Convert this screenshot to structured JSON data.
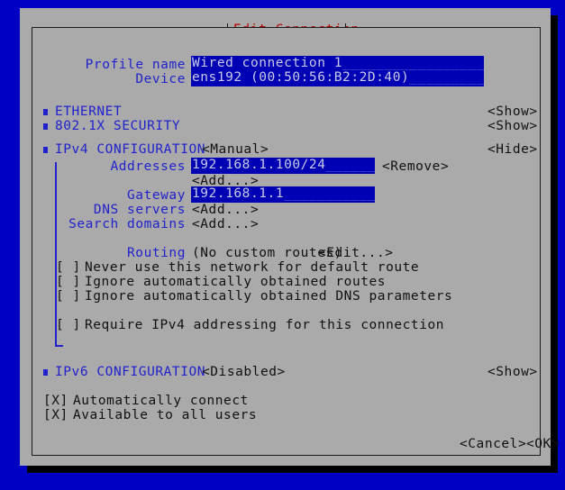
{
  "window": {
    "title": "Edit Connection",
    "accent_blue": "#0000c4",
    "panel_gray": "#aaaaaa",
    "label_blue": "#2222cc",
    "title_red": "#b00000",
    "field_blue": "#0000b5"
  },
  "form": {
    "profile_name": {
      "label": "Profile name",
      "value": "Wired connection 1",
      "fill": "____________________"
    },
    "device": {
      "label": "Device",
      "value": "ens192 (00:50:56:B2:2D:40)",
      "fill": "____________"
    }
  },
  "sections": [
    {
      "name": "ethernet",
      "label": "ETHERNET",
      "toggle": "<Show>"
    },
    {
      "name": "security",
      "label": "802.1X SECURITY",
      "toggle": "<Show>"
    },
    {
      "name": "ipv4",
      "label": "IPv4 CONFIGURATION",
      "mode": "<Manual>",
      "toggle": "<Hide>"
    },
    {
      "name": "ipv6",
      "label": "IPv6 CONFIGURATION",
      "mode": "<Disabled>",
      "toggle": "<Show>"
    }
  ],
  "ipv4": {
    "addresses": {
      "label": "Addresses",
      "value": "192.168.1.100/24",
      "fill": "________",
      "remove_label": "<Remove>",
      "add_label": "<Add...>"
    },
    "gateway": {
      "label": "Gateway",
      "value": "192.168.1.1",
      "fill": "____________"
    },
    "dns_servers": {
      "label": "DNS servers",
      "add_label": "<Add...>"
    },
    "search_domains": {
      "label": "Search domains",
      "add_label": "<Add...>"
    },
    "routing": {
      "label": "Routing",
      "summary": "(No custom routes)",
      "edit_label": "<Edit...>"
    },
    "checkboxes": [
      {
        "name": "never-default-route",
        "mark": "[ ]",
        "label": "Never use this network for default route"
      },
      {
        "name": "ignore-auto-routes",
        "mark": "[ ]",
        "label": "Ignore automatically obtained routes"
      },
      {
        "name": "ignore-auto-dns",
        "mark": "[ ]",
        "label": "Ignore automatically obtained DNS parameters"
      },
      {
        "name": "require-ipv4",
        "mark": "[ ]",
        "label": "Require IPv4 addressing for this connection"
      }
    ]
  },
  "global_options": [
    {
      "name": "automatically-connect",
      "mark": "[X]",
      "label": "Automatically connect"
    },
    {
      "name": "available-all-users",
      "mark": "[X]",
      "label": "Available to all users"
    }
  ],
  "actions": {
    "cancel": "<Cancel>",
    "ok": "<OK>"
  }
}
